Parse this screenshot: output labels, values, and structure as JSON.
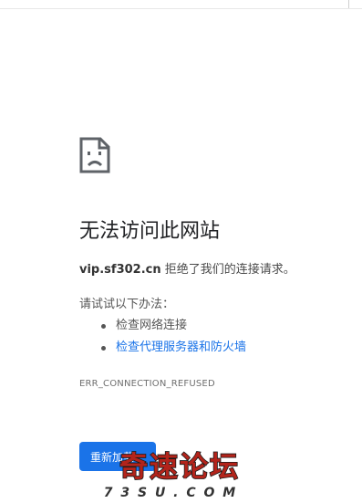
{
  "error_page": {
    "title": "无法访问此网站",
    "host": "vip.sf302.cn",
    "message_suffix": " 拒绝了我们的连接请求。",
    "suggestions_heading": "请试试以下办法：",
    "suggestions": [
      {
        "label": "检查网络连接",
        "is_link": false
      },
      {
        "label": "检查代理服务器和防火墙",
        "is_link": true
      }
    ],
    "error_code": "ERR_CONNECTION_REFUSED",
    "reload_label": "重新加载"
  },
  "watermark": {
    "title": "奇速论坛",
    "subtitle": "7 3 S U . C O M"
  },
  "colors": {
    "link": "#1a73e8",
    "button": "#1a73e8",
    "title": "#202124",
    "watermark_fill": "#b3241b",
    "watermark_outline": "#1a1a1a"
  },
  "icons": {
    "error": "sad-page-icon"
  }
}
